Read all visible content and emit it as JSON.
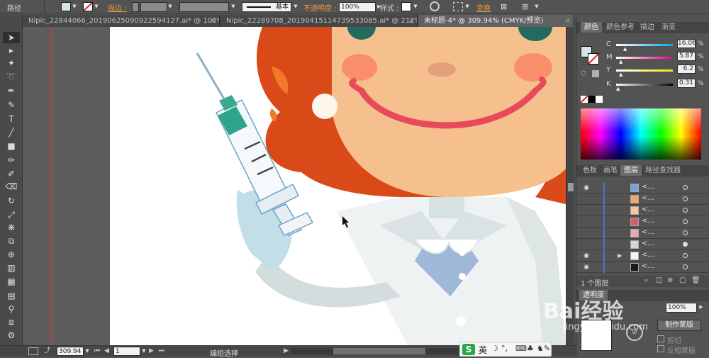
{
  "control_bar": {
    "selection_type": "路径",
    "stroke_label": "描边 :",
    "stroke_style": "基本",
    "opacity_label": "不透明度 :",
    "opacity_value": "100%",
    "style_label": "样式 :",
    "transform_label": "变换"
  },
  "tabs": [
    {
      "label": "Nipic_22844066_20190625090922594127.ai* @ 100% ..."
    },
    {
      "label": "Nipic_22289708_20190415114739533085.ai* @ 212% ..."
    },
    {
      "label": "未标题-4* @ 309.94% (CMYK/预览)"
    }
  ],
  "status_bar": {
    "zoom": "309.94",
    "page": "1",
    "tool_status": "编组选择"
  },
  "color_panel": {
    "tabs": [
      "颜色",
      "颜色参考",
      "描边",
      "渐变"
    ],
    "channels": [
      {
        "label": "C",
        "value": "16.06",
        "unit": "%",
        "fraction": 0.16
      },
      {
        "label": "M",
        "value": "5.87",
        "unit": "%",
        "fraction": 0.06
      },
      {
        "label": "Y",
        "value": "6.2",
        "unit": "%",
        "fraction": 0.06
      },
      {
        "label": "K",
        "value": "0.31",
        "unit": "%",
        "fraction": 0.0
      }
    ],
    "fill_color": "#d6e5e4"
  },
  "layers_panel": {
    "tabs": [
      "色板",
      "画笔",
      "图层",
      "路径查找器"
    ],
    "rows": [
      {
        "name": "<...",
        "thumb": "#7aa0d8",
        "eye": true
      },
      {
        "name": "<...",
        "thumb": "#f3a56b",
        "eye": false
      },
      {
        "name": "<...",
        "thumb": "#f7c39a",
        "eye": false
      },
      {
        "name": "<...",
        "thumb": "#d85a6e",
        "eye": false
      },
      {
        "name": "<...",
        "thumb": "#e8a8b0",
        "eye": false
      },
      {
        "name": "<...",
        "thumb": "#cfdada",
        "eye": false
      },
      {
        "name": "<...",
        "thumb": "#f5f5f5",
        "eye": true
      },
      {
        "name": "<...",
        "thumb": "#1a1a1a",
        "eye": true
      }
    ],
    "footer_label": "1 个图层"
  },
  "transparency_panel": {
    "tab": "透明度",
    "opacity_value": "100%",
    "make_mask_button": "制作蒙版",
    "clip_label": "剪切",
    "invert_mask_label": "反相蒙版"
  },
  "taskbar_ime": {
    "lang": "英"
  },
  "watermark": {
    "text": "Bai经验",
    "url": "jingyan.baidu.com"
  }
}
